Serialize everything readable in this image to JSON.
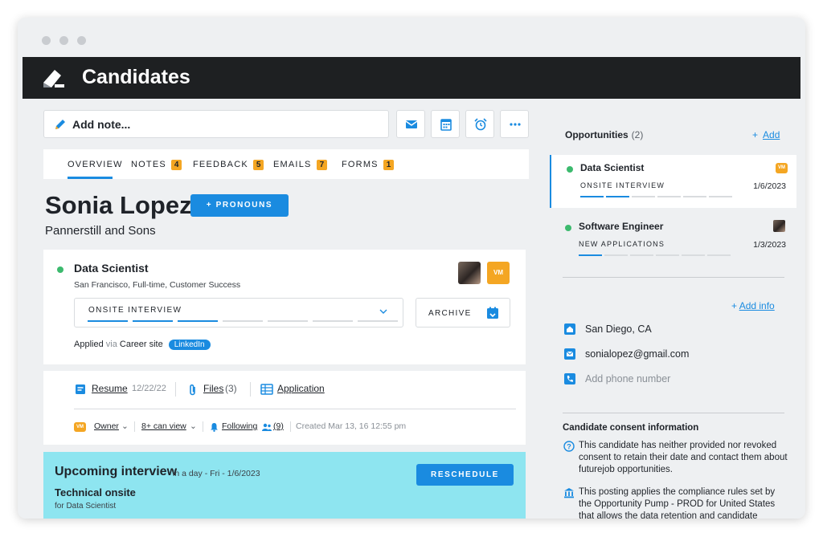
{
  "app": {
    "title": "Candidates"
  },
  "toolbar": {
    "add_note_label": "Add note..."
  },
  "tabs": [
    {
      "label": "OVERVIEW",
      "count": ""
    },
    {
      "label": "NOTES",
      "count": "4"
    },
    {
      "label": "FEEDBACK",
      "count": "5"
    },
    {
      "label": "EMAILS",
      "count": "7"
    },
    {
      "label": "FORMS",
      "count": "1"
    }
  ],
  "candidate": {
    "name": "Sonia Lopez",
    "pronouns_button": "+ PRONOUNS",
    "company": "Pannerstill and Sons"
  },
  "job_card": {
    "title": "Data Scientist",
    "meta": "San Francisco, Full-time, Customer Success",
    "owner_badge": "VM",
    "stage": "ONSITE INTERVIEW",
    "stage_progress_segments": 7,
    "stage_progress_filled": 3,
    "archive_label": "ARCHIVE",
    "applied_prefix": "Applied",
    "applied_via": "via",
    "applied_source": "Career site",
    "applied_tag": "LinkedIn"
  },
  "files": {
    "resume_label": "Resume",
    "resume_date": "12/22/22",
    "files_label": "Files",
    "files_count": "(3)",
    "application_label": "Application",
    "owner_badge": "VM",
    "owner_label": "Owner",
    "can_view_label": "8+ can view",
    "following_label": "Following",
    "followers_count": "(9)",
    "created_label": "Created Mar 13, 16 12:55 pm"
  },
  "interview": {
    "title": "Upcoming interview",
    "when": "in a day - Fri - 1/6/2023",
    "subtitle": "Technical onsite",
    "for_label": "for Data Scientist",
    "reschedule_label": "RESCHEDULE"
  },
  "opportunities": {
    "header": "Opportunities",
    "count": "(2)",
    "add_label": "Add",
    "items": [
      {
        "title": "Data Scientist",
        "stage": "ONSITE INTERVIEW",
        "date": "1/6/2023",
        "badge": "VM",
        "progress_segments": 6,
        "progress_filled": 2
      },
      {
        "title": "Software Engineer",
        "stage": "NEW APPLICATIONS",
        "date": "1/3/2023",
        "badge": "",
        "progress_segments": 6,
        "progress_filled": 1
      }
    ]
  },
  "contact": {
    "add_info_label": "Add info",
    "location": "San Diego, CA",
    "email": "sonialopez@gmail.com",
    "phone_placeholder": "Add phone number"
  },
  "consent": {
    "title": "Candidate consent information",
    "status_text": "This candidate has neither provided nor revoked consent to retain their date and contact them about futurejob opportunities.",
    "policy_text": "This posting applies the compliance rules set by the Opportunity Pump - PROD for United States that allows the data retention and candidate outreach to expire immediately when"
  },
  "colors": {
    "accent": "#1a8be0",
    "badge_orange": "#f4a623",
    "status_green": "#3cba6e",
    "appbar_bg": "#1e2022",
    "interview_bg": "#8ee5f0"
  }
}
